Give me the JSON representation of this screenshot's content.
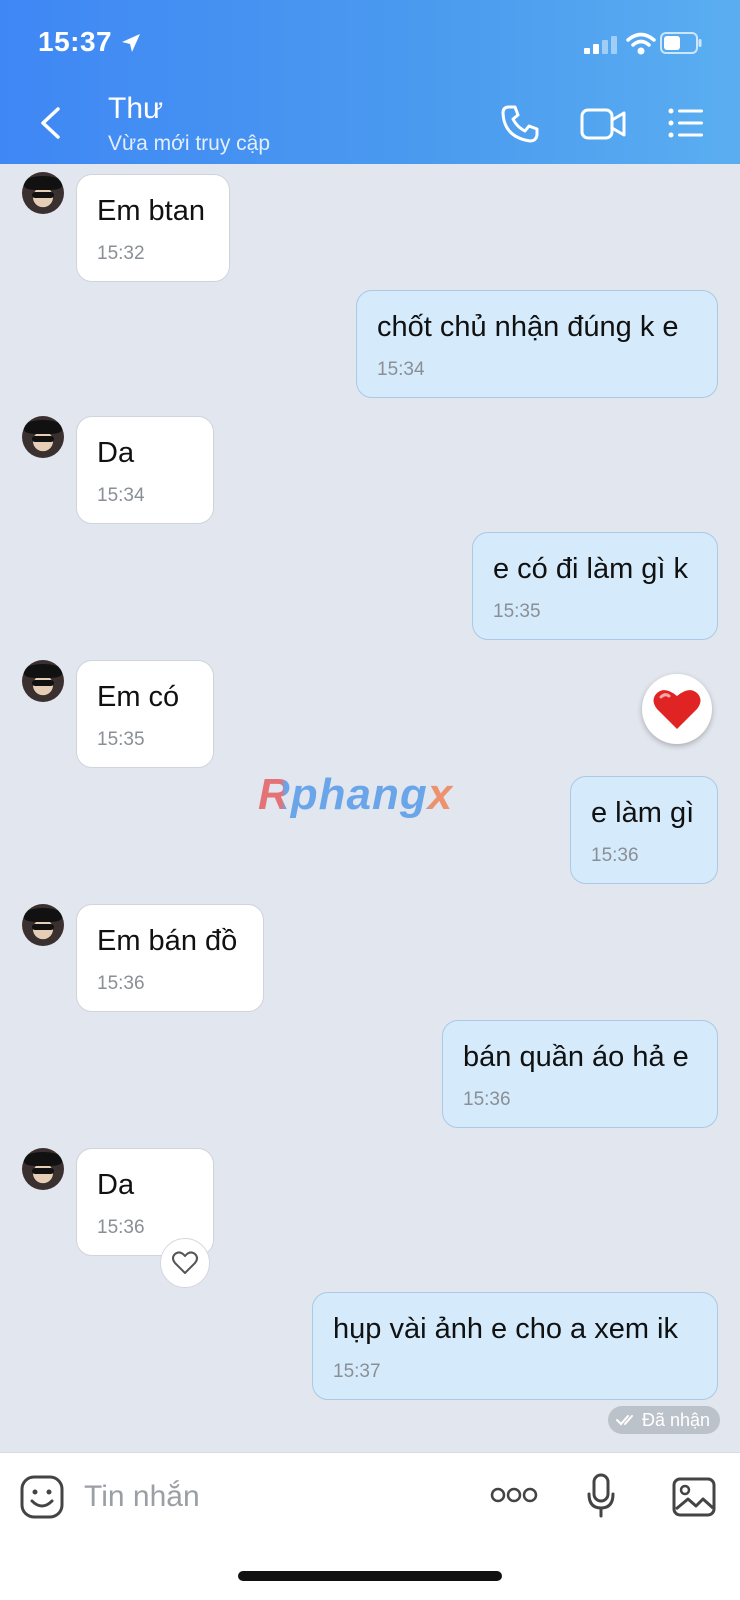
{
  "status_bar": {
    "time": "15:37"
  },
  "header": {
    "name": "Thư",
    "status": "Vừa mới truy cập"
  },
  "messages": [
    {
      "dir": "in",
      "text": "Em btan",
      "time": "15:32"
    },
    {
      "dir": "out",
      "text": "chốt chủ nhận đúng k e",
      "time": "15:34"
    },
    {
      "dir": "in",
      "text": "Da",
      "time": "15:34"
    },
    {
      "dir": "out",
      "text": "e có đi làm gì k",
      "time": "15:35"
    },
    {
      "dir": "in",
      "text": "Em có",
      "time": "15:35"
    },
    {
      "dir": "out",
      "text": "e làm gì",
      "time": "15:36"
    },
    {
      "dir": "in",
      "text": "Em bán đồ",
      "time": "15:36"
    },
    {
      "dir": "out",
      "text": "bán quần áo hả e",
      "time": "15:36"
    },
    {
      "dir": "in",
      "text": "Da",
      "time": "15:36"
    },
    {
      "dir": "out",
      "text": "hụp vài ảnh e cho a xem ik",
      "time": "15:37"
    }
  ],
  "delivery_status": "Đã nhận",
  "watermark": "Rphangx",
  "composer": {
    "placeholder": "Tin nhắn"
  },
  "colors": {
    "header_accent": "#4b9bef",
    "outgoing_bubble": "#d5ebfb",
    "incoming_bubble": "#ffffff",
    "chat_bg": "#e2e6ee"
  }
}
